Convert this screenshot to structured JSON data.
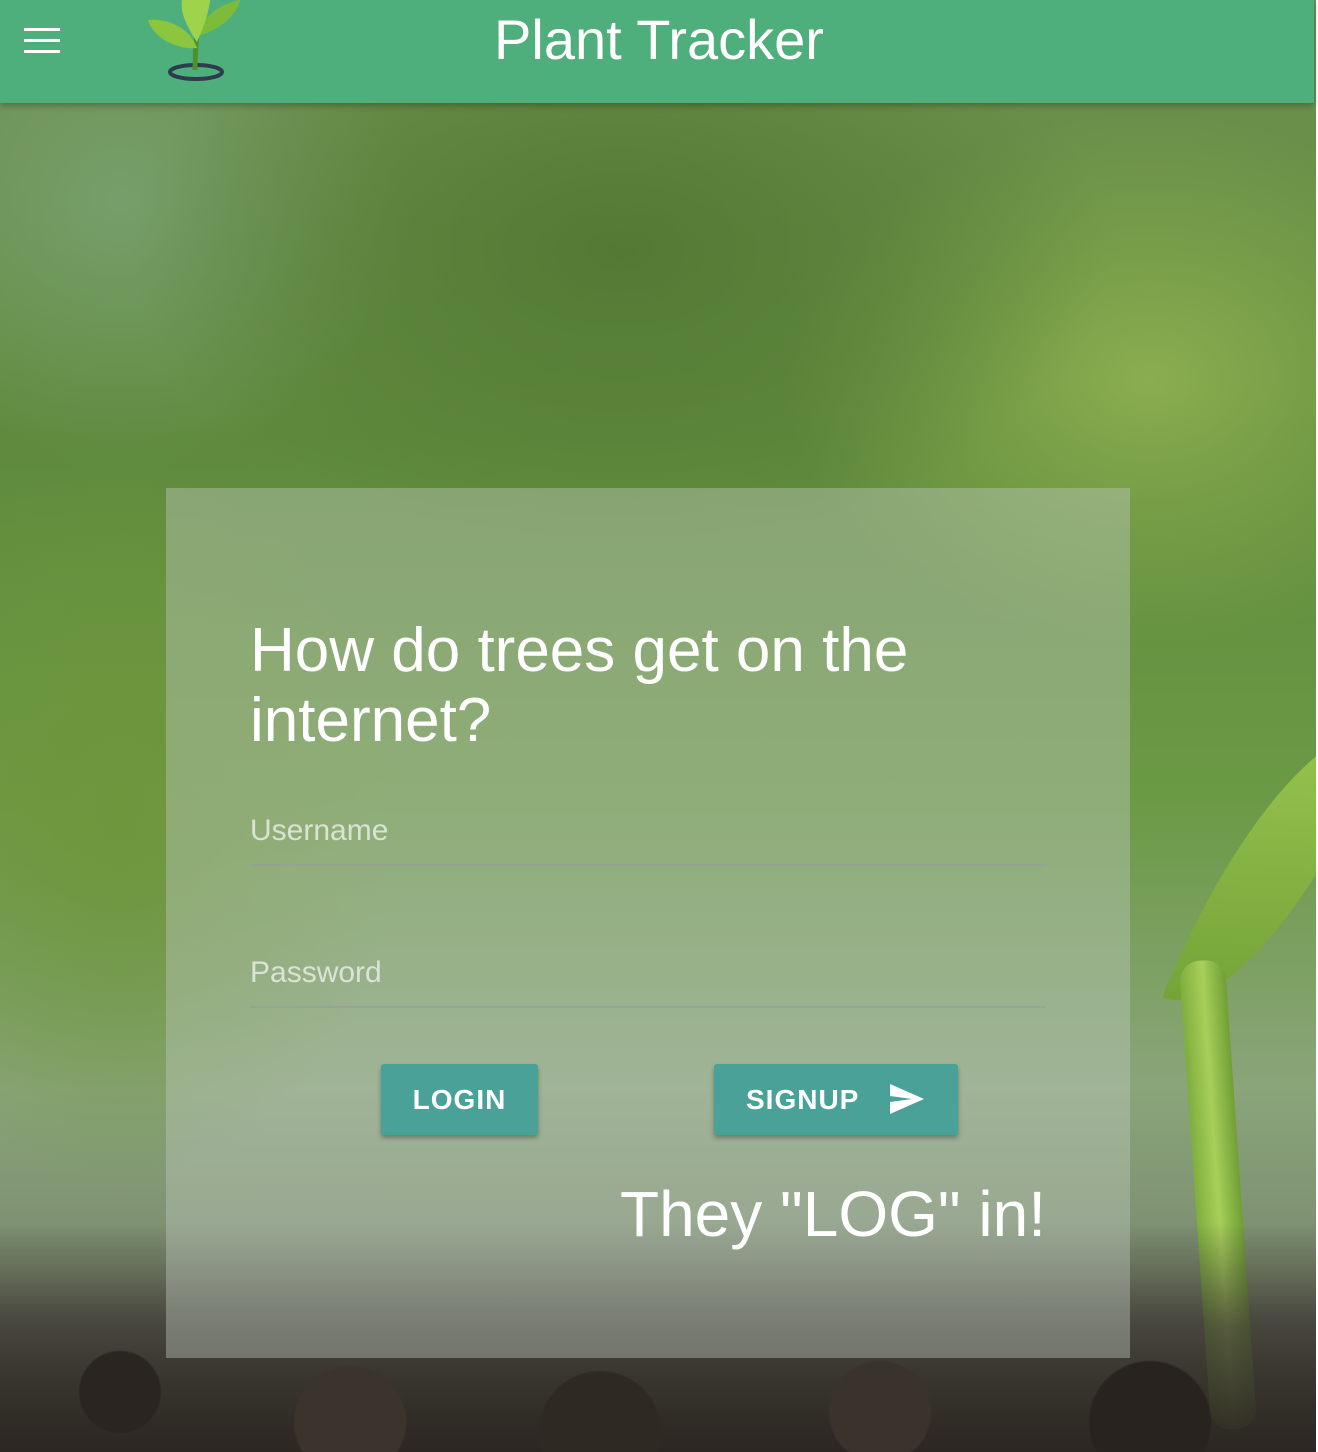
{
  "app_bar": {
    "title": "Plant Tracker",
    "menu_icon": "hamburger-menu-icon",
    "logo_icon": "sprout-pot-logo-icon",
    "color": "#4faf7c"
  },
  "login_card": {
    "question": "How do trees get on the internet?",
    "username": {
      "placeholder": "Username",
      "value": ""
    },
    "password": {
      "placeholder": "Password",
      "value": ""
    },
    "login_label": "LOGIN",
    "signup_label": "SIGNUP",
    "signup_icon": "send-icon",
    "button_color": "#4aa198",
    "punchline": "They \"LOG\" in!"
  }
}
